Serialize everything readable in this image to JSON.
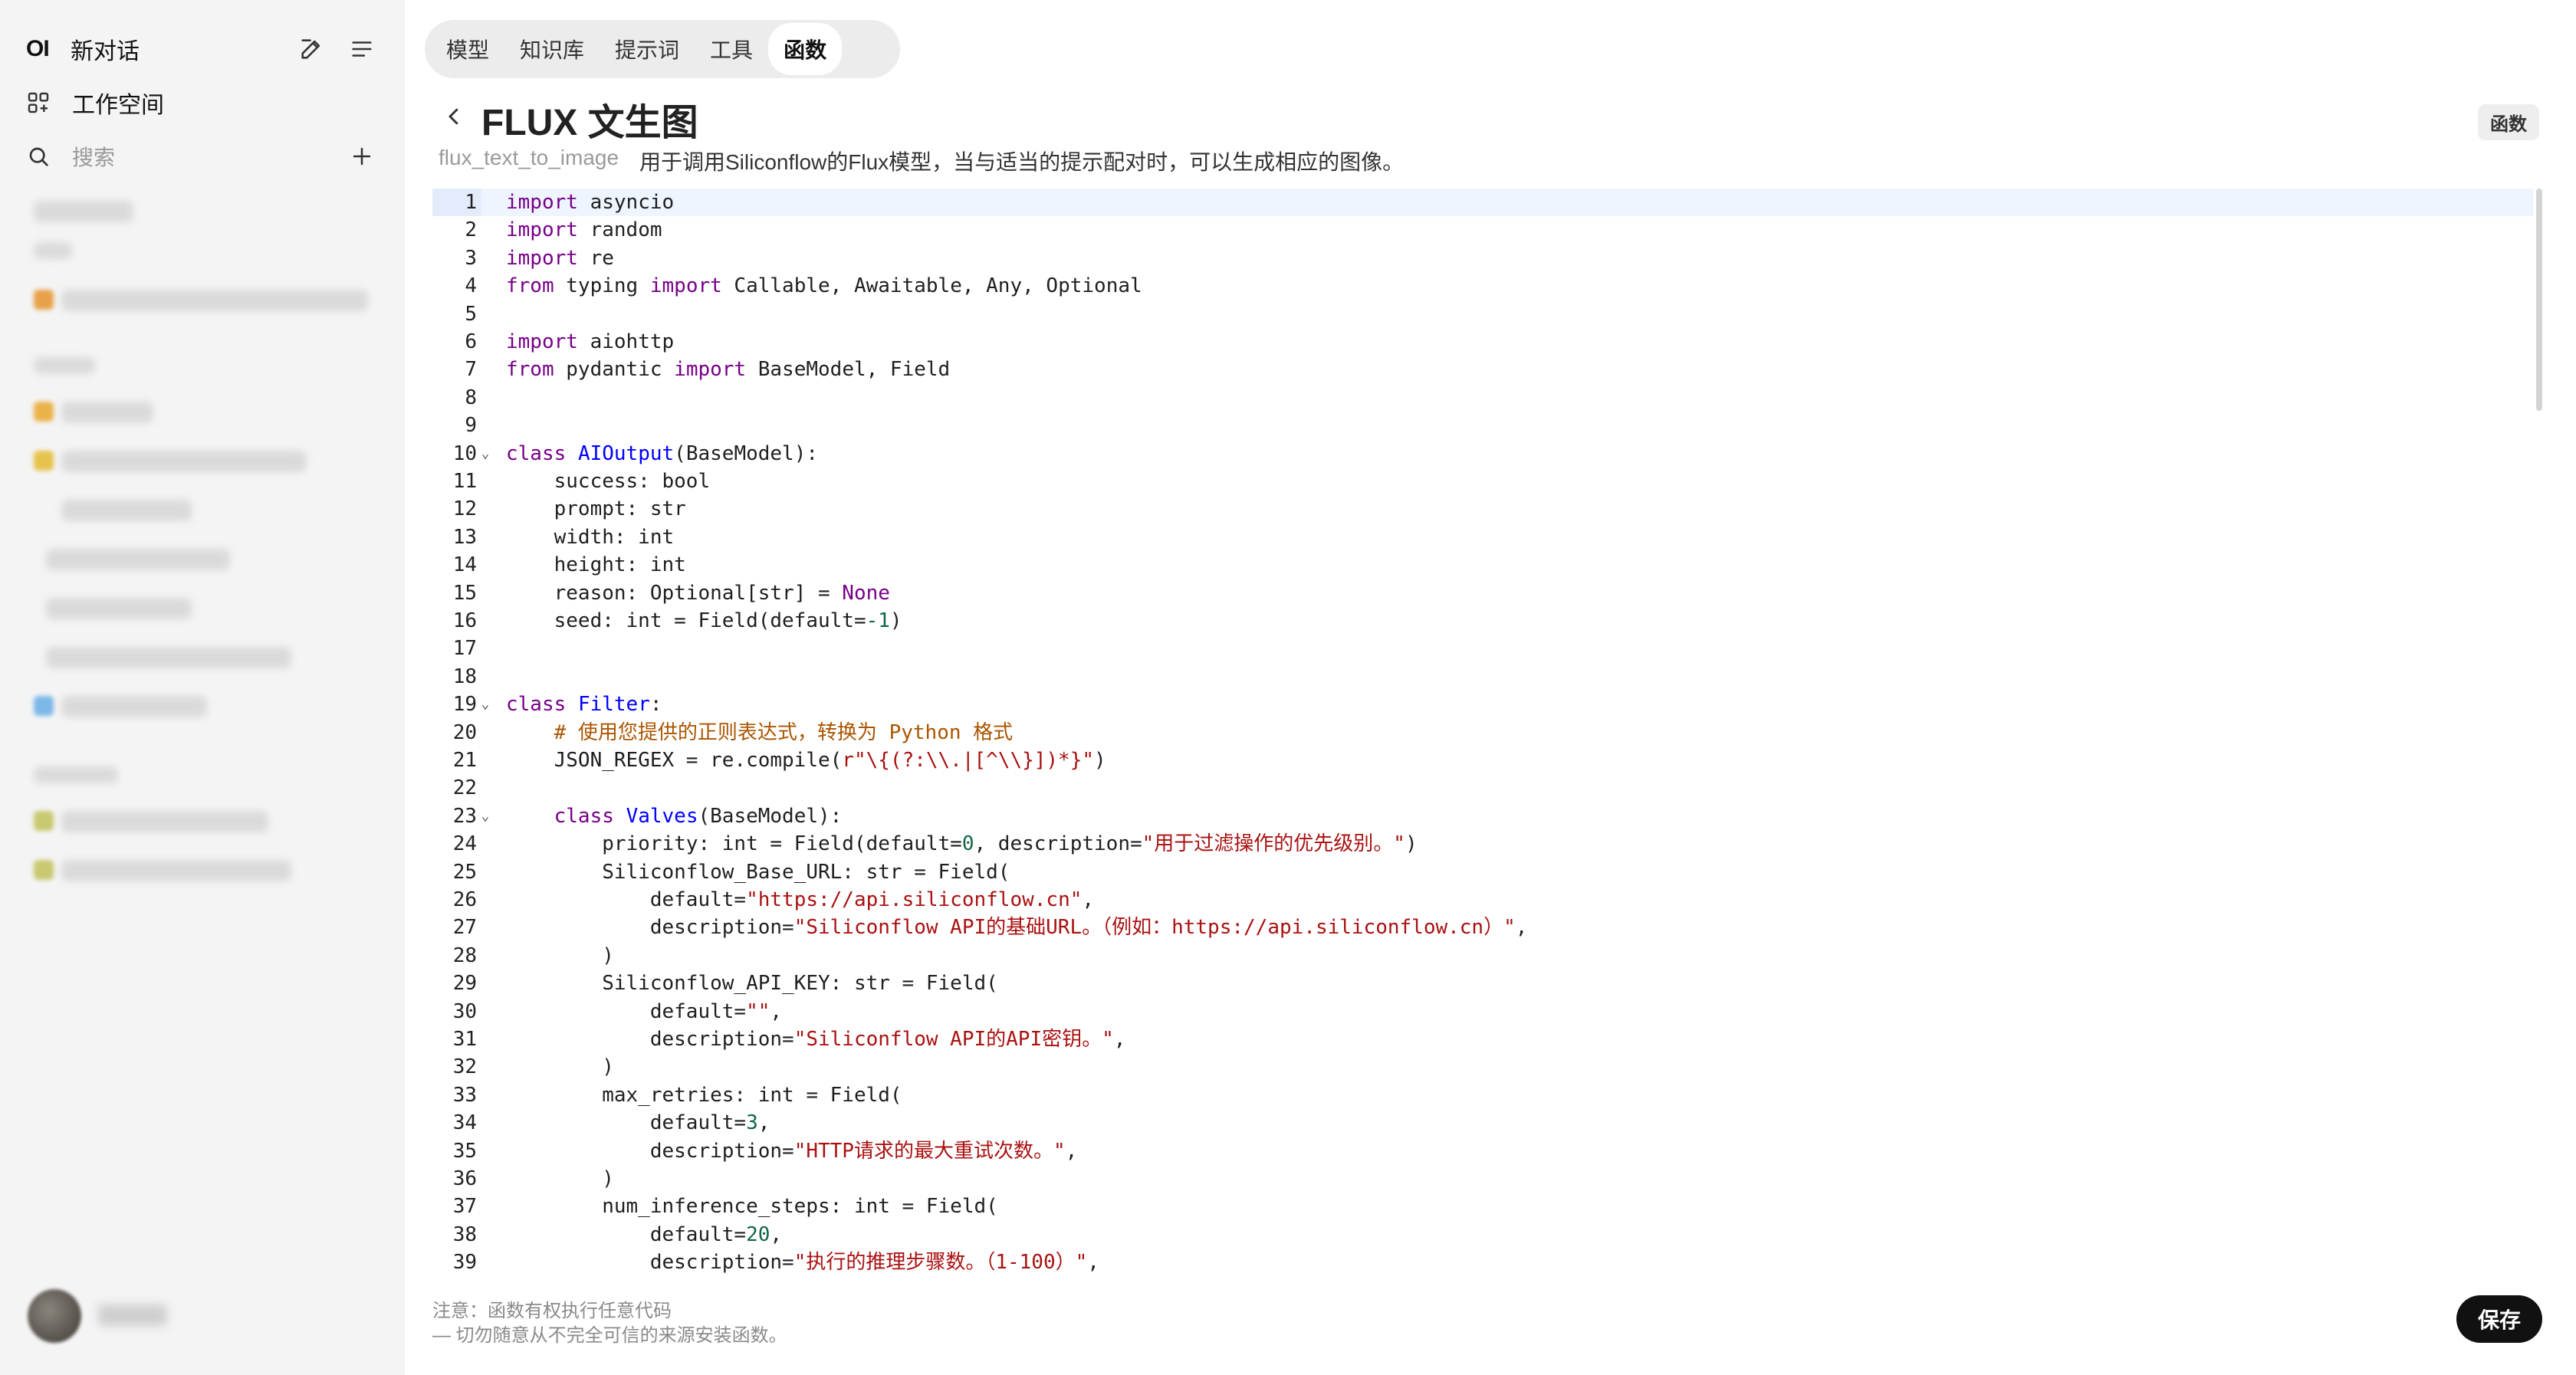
{
  "sidebar": {
    "logo": "OI",
    "new_chat": "新对话",
    "workspace": "工作空间",
    "search_placeholder": "搜索"
  },
  "tabs": [
    {
      "label": "模型"
    },
    {
      "label": "知识库"
    },
    {
      "label": "提示词"
    },
    {
      "label": "工具"
    },
    {
      "label": "函数"
    }
  ],
  "active_tab": "函数",
  "function": {
    "title": "FLUX 文生图",
    "type_badge": "函数",
    "id": "flux_text_to_image",
    "description": "用于调用Siliconflow的Flux模型，当与适当的提示配对时，可以生成相应的图像。"
  },
  "editor": {
    "lines": [
      "import asyncio",
      "import random",
      "import re",
      "from typing import Callable, Awaitable, Any, Optional",
      "",
      "import aiohttp",
      "from pydantic import BaseModel, Field",
      "",
      "",
      "class AIOutput(BaseModel):",
      "    success: bool",
      "    prompt: str",
      "    width: int",
      "    height: int",
      "    reason: Optional[str] = None",
      "    seed: int = Field(default=-1)",
      "",
      "",
      "class Filter:",
      "    # 使用您提供的正则表达式，转换为 Python 格式",
      "    JSON_REGEX = re.compile(r\"\\{(?:\\\\.|[^\\\\}])*}\")",
      "",
      "    class Valves(BaseModel):",
      "        priority: int = Field(default=0, description=\"用于过滤操作的优先级别。\")",
      "        Siliconflow_Base_URL: str = Field(",
      "            default=\"https://api.siliconflow.cn\",",
      "            description=\"Siliconflow API的基础URL。（例如：https://api.siliconflow.cn）\",",
      "        )",
      "        Siliconflow_API_KEY: str = Field(",
      "            default=\"\",",
      "            description=\"Siliconflow API的API密钥。\",",
      "        )",
      "        max_retries: int = Field(",
      "            default=3,",
      "            description=\"HTTP请求的最大重试次数。\",",
      "        )",
      "        num_inference_steps: int = Field(",
      "            default=20,",
      "            description=\"执行的推理步骤数。（1-100）\","
    ],
    "fold_lines": [
      10,
      19,
      23
    ],
    "active_line": 1
  },
  "footer": {
    "warning_line1": "注意：函数有权执行任意代码",
    "warning_line2": "— 切勿随意从不完全可信的来源安装函数。",
    "save_label": "保存"
  }
}
